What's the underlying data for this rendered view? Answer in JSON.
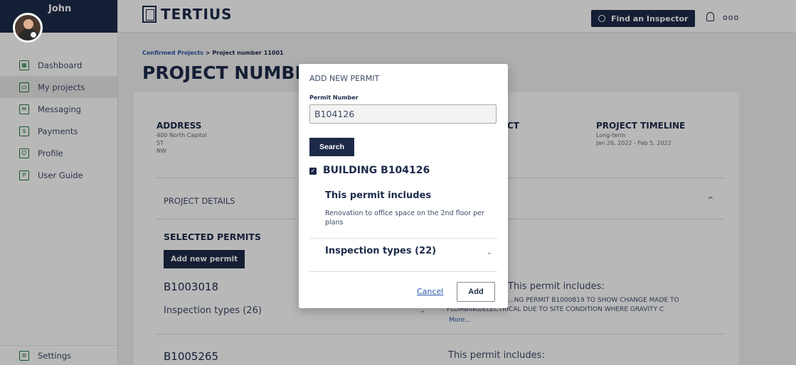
{
  "user": {
    "name": "John"
  },
  "sidebar": {
    "items": [
      {
        "label": "Dashboard",
        "icon": "dashboard-icon",
        "active": false
      },
      {
        "label": "My projects",
        "icon": "projects-icon",
        "active": true
      },
      {
        "label": "Messaging",
        "icon": "messaging-icon",
        "active": false
      },
      {
        "label": "Payments",
        "icon": "payments-icon",
        "active": false
      },
      {
        "label": "Profile",
        "icon": "profile-icon",
        "active": false
      },
      {
        "label": "User Guide",
        "icon": "pdf-icon",
        "active": false
      }
    ],
    "settings_label": "Settings"
  },
  "topbar": {
    "logo": "TERTIUS",
    "find_inspector_label": "Find an Inspector",
    "more": "ooo"
  },
  "breadcrumb": {
    "parent": "Confirmed Projects",
    "separator": ">",
    "current": "Project number 11001"
  },
  "page_title": "PROJECT NUMBER 11001",
  "project": {
    "address_label": "ADDRESS",
    "address_lines": [
      "400 North Capitol",
      "ST",
      "NW"
    ],
    "contact_label_partial": "CT",
    "timeline_label": "PROJECT TIMELINE",
    "timeline_type": "Long-term",
    "timeline_dates": "Jan 26, 2022 - Feb 5, 2022",
    "details_label": "PROJECT DETAILS",
    "selected_permits_label": "SELECTED PERMITS",
    "add_new_permit_label": "Add new permit",
    "permits": [
      {
        "number": "B1003018",
        "inspection_types": "Inspection types (26)",
        "includes_label": "This permit includes:",
        "includes_text_1": "...NG PERMIT B1000819 TO SHOW CHANGE MADE TO",
        "includes_text_2": "PLUMBING/ELECTRICAL DUE TO SITE CONDITION WHERE GRAVITY C",
        "more_label": "More..."
      },
      {
        "number": "B1005265",
        "includes_label": "This permit includes:"
      }
    ]
  },
  "modal": {
    "title": "ADD NEW PERMIT",
    "field_label": "Permit Number",
    "field_value": "B104126",
    "search_label": "Search",
    "result_title": "BUILDING B104126",
    "includes_heading": "This permit includes",
    "includes_text": "Renovation to office space on the 2nd floor per plans",
    "inspection_types": "Inspection types (22)",
    "cancel_label": "Cancel",
    "add_label": "Add"
  },
  "colors": {
    "navy": "#1c2a4a",
    "link": "#2a5aa8",
    "icon_green": "#1f7a3a"
  }
}
